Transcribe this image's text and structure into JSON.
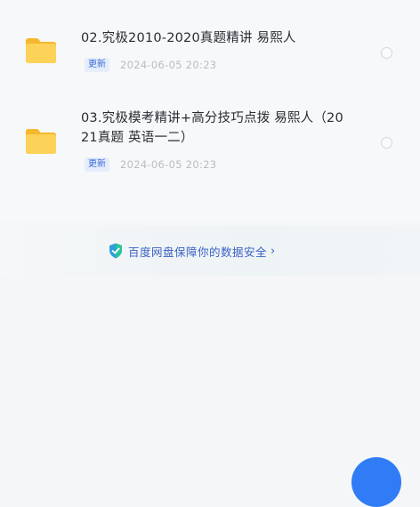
{
  "files": [
    {
      "name": "02.究极2010-2020真题精讲 易熙人",
      "tag": "更新",
      "date": "2024-06-05 20:23"
    },
    {
      "name": "03.究极模考精讲+高分技巧点拨 易熙人（2021真题 英语一二）",
      "tag": "更新",
      "date": "2024-06-05 20:23"
    }
  ],
  "security": {
    "text": "百度网盘保障你的数据安全",
    "chevron": "›",
    "icon": "shield-check-icon"
  },
  "colors": {
    "accent": "#3a62c4",
    "folder": "#f7c948",
    "fab": "#2f7cf6"
  }
}
